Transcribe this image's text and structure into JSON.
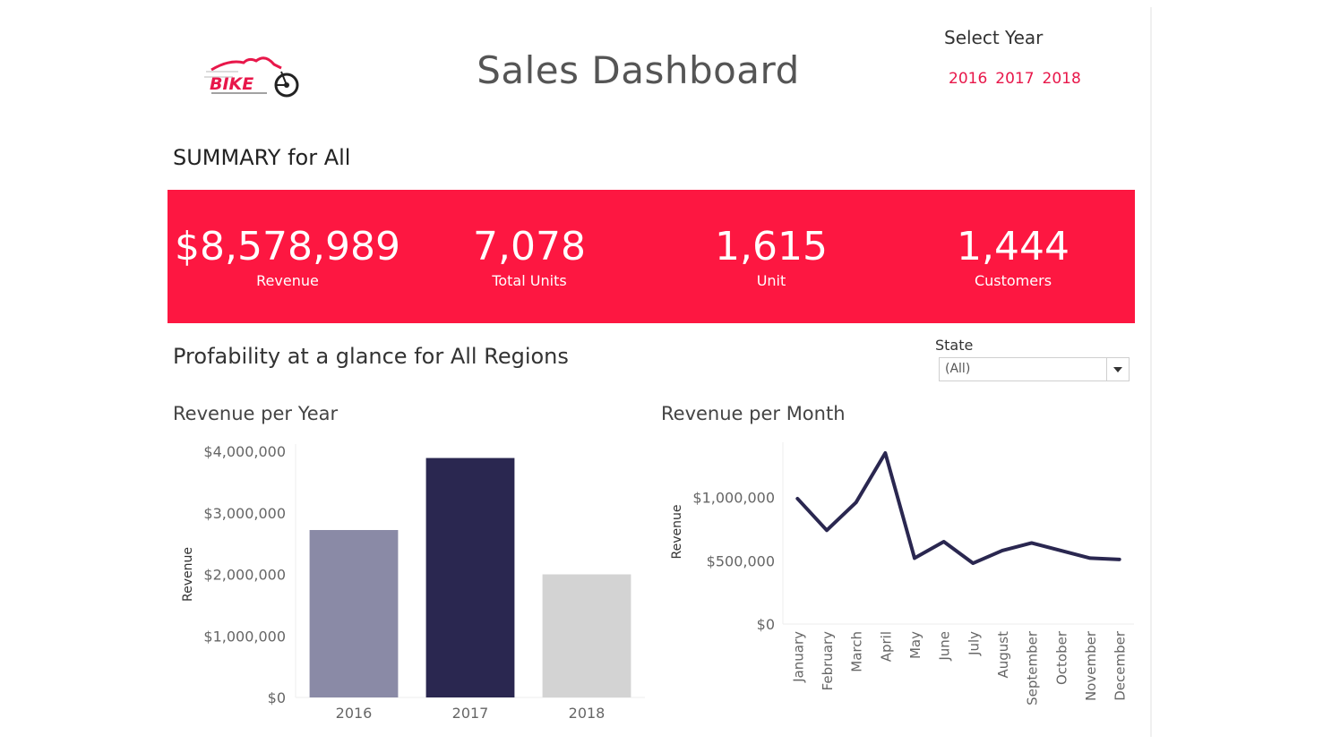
{
  "header": {
    "title": "Sales Dashboard",
    "logo_text": "BIKE",
    "year_filter_label": "Select Year",
    "year_options": [
      "2016",
      "2017",
      "2018"
    ],
    "accent_color": "#e8174a"
  },
  "summary": {
    "title": "SUMMARY for All",
    "band_color": "#fd1741",
    "kpis": [
      {
        "value": "$8,578,989",
        "label": "Revenue"
      },
      {
        "value": "7,078",
        "label": "Total Units"
      },
      {
        "value": "1,615",
        "label": "Unit"
      },
      {
        "value": "1,444",
        "label": "Customers"
      }
    ]
  },
  "profitability": {
    "title": "Profability at a glance for All Regions",
    "state_filter": {
      "label": "State",
      "value": "(All)",
      "icon": "chevron-down-icon"
    }
  },
  "chart_data": [
    {
      "type": "bar",
      "title": "Revenue per Year",
      "ylabel": "Revenue",
      "categories": [
        "2016",
        "2017",
        "2018"
      ],
      "values": [
        2720000,
        3890000,
        2000000
      ],
      "colors": [
        "#8a8aa6",
        "#2a2750",
        "#d3d3d3"
      ],
      "ylim": [
        0,
        4000000
      ],
      "yticks": [
        0,
        1000000,
        2000000,
        3000000,
        4000000
      ],
      "ytick_labels": [
        "$0",
        "$1,000,000",
        "$2,000,000",
        "$3,000,000",
        "$4,000,000"
      ],
      "grid": false
    },
    {
      "type": "line",
      "title": "Revenue per Month",
      "ylabel": "Revenue",
      "categories": [
        "January",
        "February",
        "March",
        "April",
        "May",
        "June",
        "July",
        "August",
        "September",
        "October",
        "November",
        "December"
      ],
      "values": [
        990000,
        740000,
        960000,
        1350000,
        520000,
        650000,
        480000,
        580000,
        640000,
        580000,
        520000,
        510000
      ],
      "color": "#2a2750",
      "ylim": [
        0,
        1350000
      ],
      "yticks": [
        0,
        500000,
        1000000
      ],
      "ytick_labels": [
        "$0",
        "$500,000",
        "$1,000,000"
      ],
      "grid": false
    }
  ]
}
